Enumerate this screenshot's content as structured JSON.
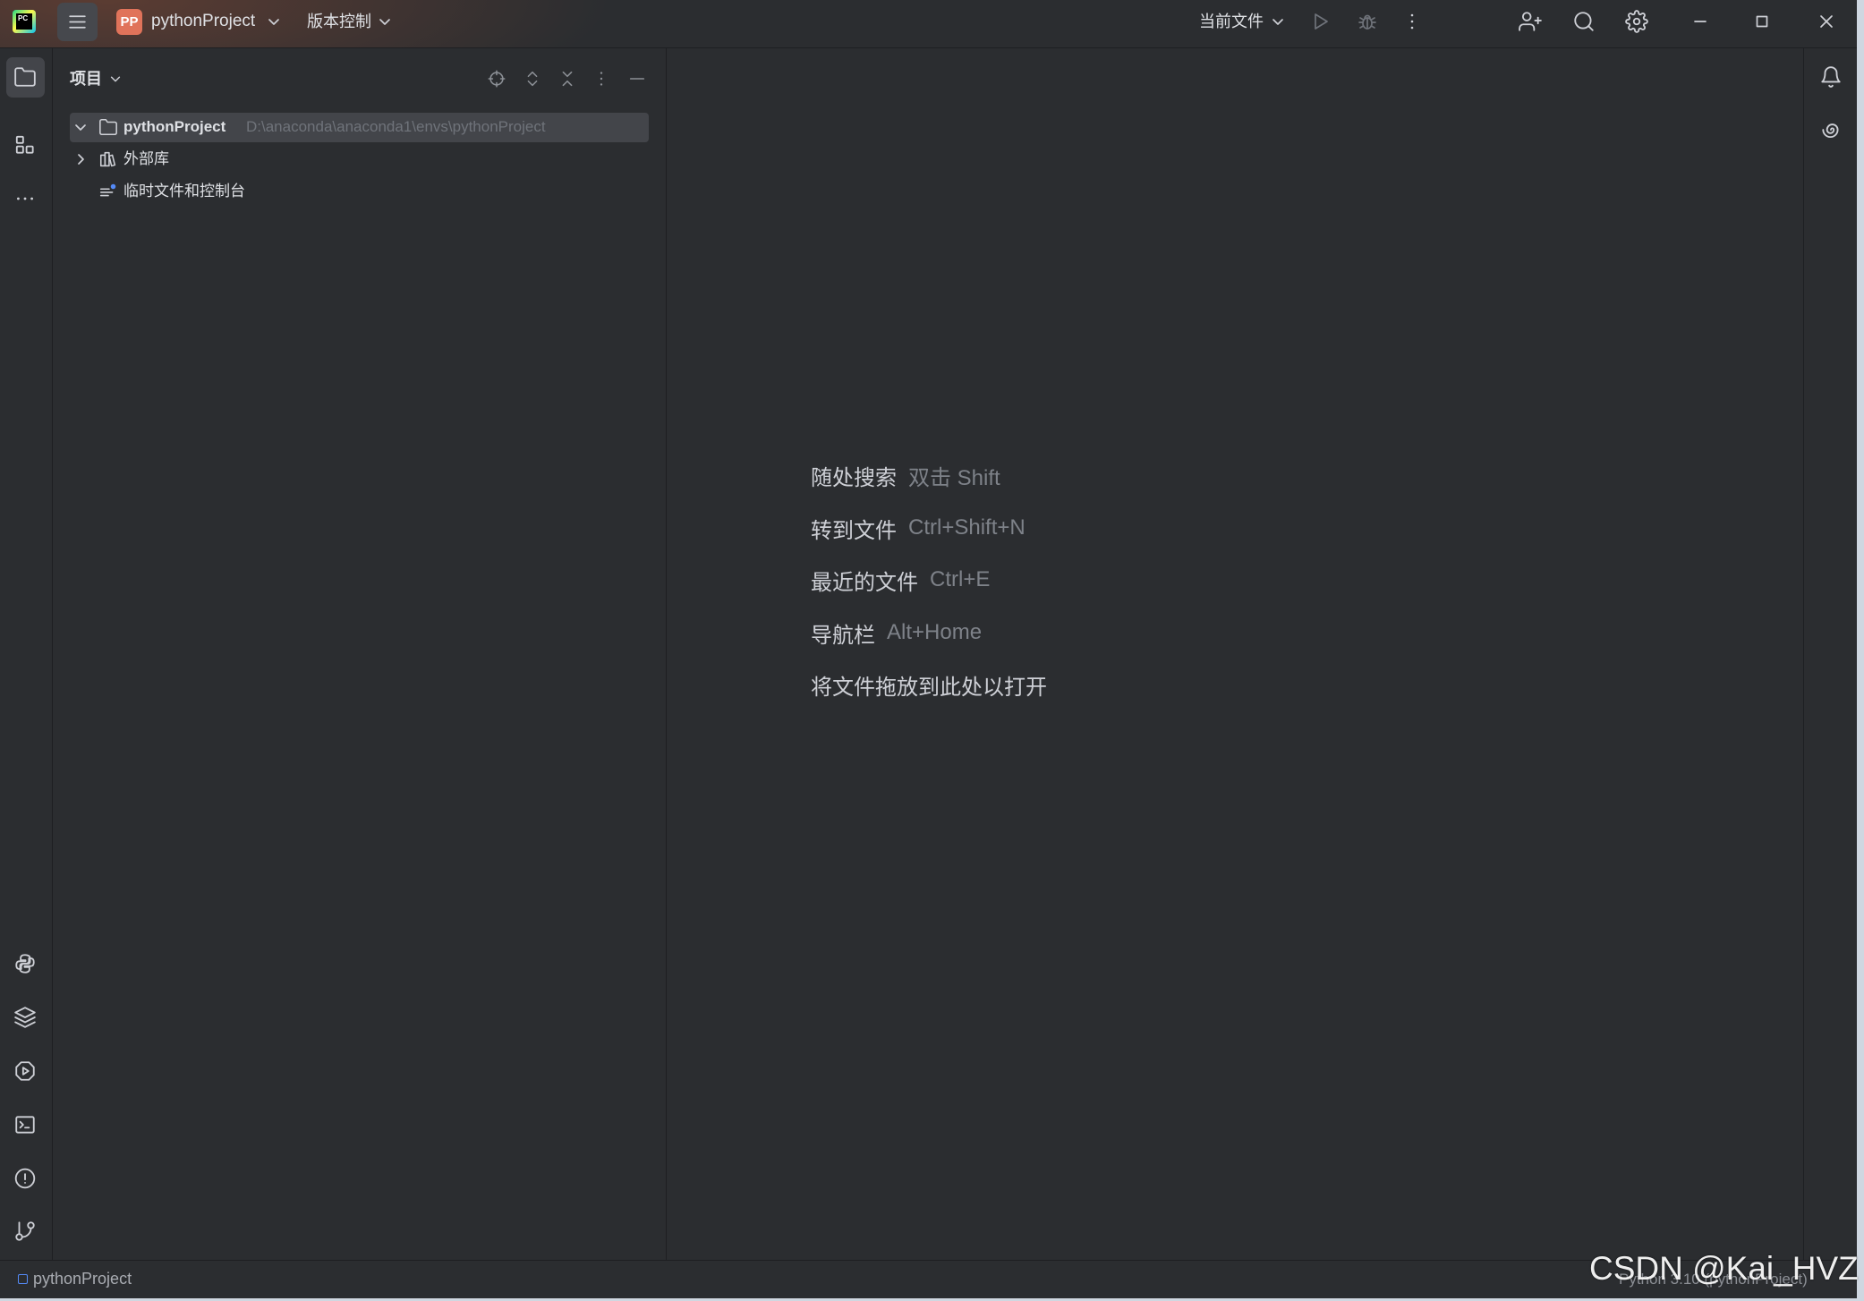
{
  "titlebar": {
    "logo_text": "PC",
    "project_badge": "PP",
    "project_name": "pythonProject",
    "vcs_label": "版本控制",
    "run_config": "当前文件",
    "icons": [
      "hamburger-icon",
      "chevron-down-icon",
      "run-icon",
      "debug-icon",
      "more-vertical-icon",
      "add-user-icon",
      "search-icon",
      "settings-icon",
      "minimize-icon",
      "maximize-icon",
      "close-icon"
    ]
  },
  "left_toolbar": {
    "top_icons": [
      "folder-icon",
      "structure-icon",
      "more-horizontal-icon"
    ],
    "bottom_icons": [
      "python-console-icon",
      "python-packages-icon",
      "services-icon",
      "terminal-icon",
      "problems-icon",
      "git-icon"
    ],
    "active": "folder-icon"
  },
  "project_panel": {
    "title": "项目",
    "header_icons": [
      "locate-icon",
      "expand-all-icon",
      "collapse-all-icon",
      "more-vertical-icon",
      "hide-icon"
    ],
    "tree": [
      {
        "label": "pythonProject",
        "path": "D:\\anaconda\\anaconda1\\envs\\pythonProject",
        "icon": "folder-icon",
        "expanded": true,
        "selected": true
      },
      {
        "label": "外部库",
        "icon": "library-icon",
        "expanded": false
      },
      {
        "label": "临时文件和控制台",
        "icon": "scratches-icon"
      }
    ]
  },
  "editor": {
    "hints": [
      {
        "action": "随处搜索",
        "shortcut": "双击 Shift"
      },
      {
        "action": "转到文件",
        "shortcut": "Ctrl+Shift+N"
      },
      {
        "action": "最近的文件",
        "shortcut": "Ctrl+E"
      },
      {
        "action": "导航栏",
        "shortcut": "Alt+Home"
      },
      {
        "action": "将文件拖放到此处以打开"
      }
    ]
  },
  "right_toolbar": {
    "icons": [
      "notifications-icon",
      "ai-assistant-icon"
    ]
  },
  "status_bar": {
    "project": "pythonProject",
    "interpreter": "Python 3.10 (pythonProject)"
  },
  "watermark": "CSDN @Kai_HVZ",
  "colors": {
    "window_bg": "#2b2d30",
    "border": "#1e1f22",
    "title_tint": "#824834",
    "project_badge": "#e0735a",
    "selection": "#43454a",
    "text": "#dfe1e5",
    "muted_text": "#6f737a",
    "accent": "#548af7"
  }
}
